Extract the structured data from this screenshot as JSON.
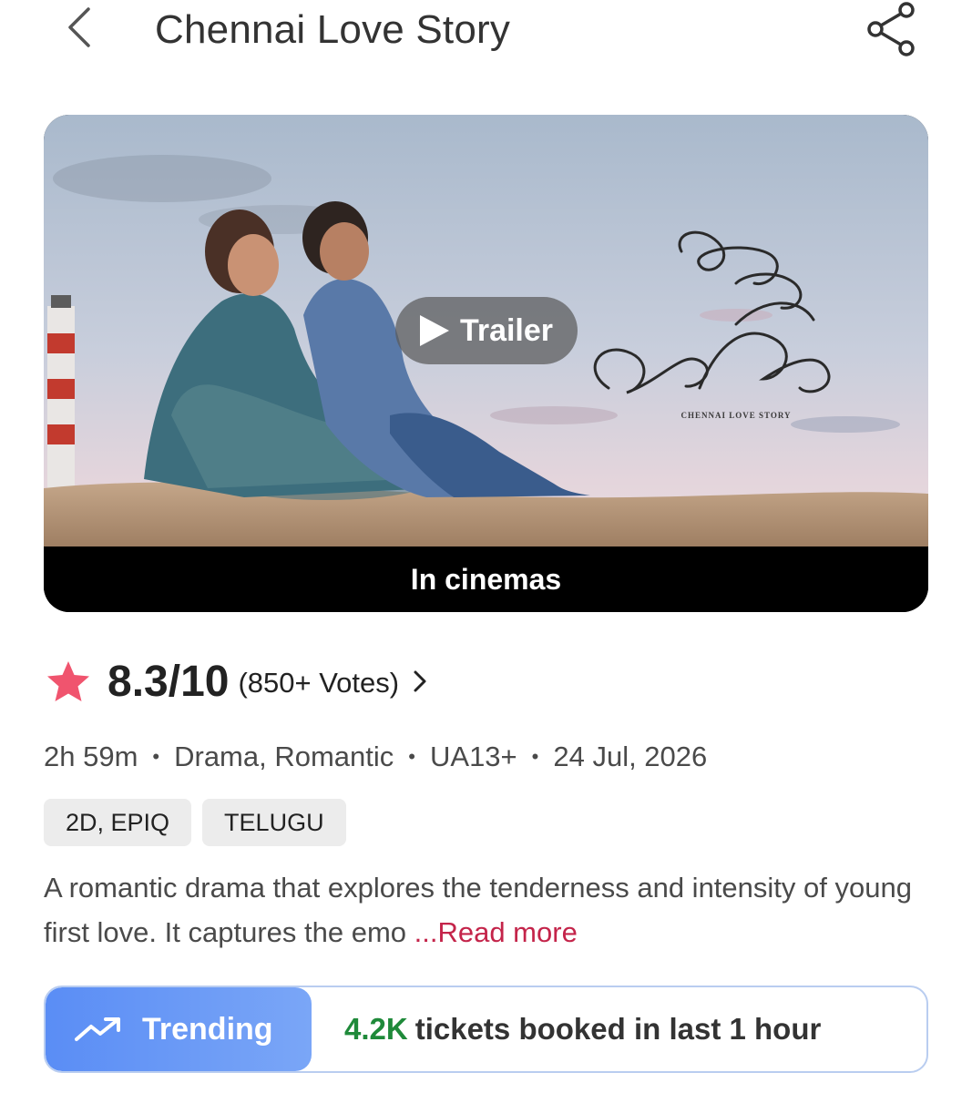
{
  "header": {
    "title": "Chennai Love Story",
    "back_icon": "chevron-left-icon",
    "share_icon": "share-icon"
  },
  "banner": {
    "poster_title_en": "CHENNAI LOVE STORY",
    "trailer_label": "Trailer",
    "status_label": "In cinemas"
  },
  "rating": {
    "score": "8.3/10",
    "votes": "(850+ Votes)",
    "star_color": "#f0546e"
  },
  "meta": {
    "duration": "2h 59m",
    "genres": "Drama, Romantic",
    "certificate": "UA13+",
    "release_date": "24 Jul, 2026"
  },
  "tags": [
    "2D, EPIQ",
    "TELUGU"
  ],
  "description": {
    "text": "A romantic drama that explores the tenderness and intensity of young first love. It captures the emo ",
    "read_more": "...Read more"
  },
  "trending": {
    "label": "Trending",
    "count": "4.2K",
    "suffix": "tickets booked in last 1 hour",
    "accent": "#5a8df5",
    "count_color": "#1f8a3a"
  }
}
